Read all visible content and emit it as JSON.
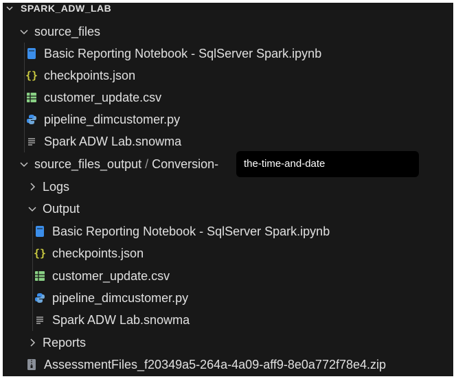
{
  "explorer": {
    "root": {
      "label": "SPARK_ADW_LAB",
      "expanded": true
    },
    "source_files": {
      "label": "source_files",
      "items": [
        {
          "label": "Basic Reporting Notebook - SqlServer Spark.ipynb",
          "icon": "notebook-icon"
        },
        {
          "label": "checkpoints.json",
          "icon": "json-braces-icon"
        },
        {
          "label": "customer_update.csv",
          "icon": "csv-table-icon"
        },
        {
          "label": "pipeline_dimcustomer.py",
          "icon": "python-icon"
        },
        {
          "label": "Spark ADW Lab.snowma",
          "icon": "text-lines-icon"
        }
      ]
    },
    "source_files_output": {
      "label": "source_files_output",
      "path_sep": " / ",
      "path_child": "Conversion-",
      "logs": {
        "label": "Logs"
      },
      "output": {
        "label": "Output",
        "items": [
          {
            "label": "Basic Reporting Notebook - SqlServer Spark.ipynb",
            "icon": "notebook-icon"
          },
          {
            "label": "checkpoints.json",
            "icon": "json-braces-icon"
          },
          {
            "label": "customer_update.csv",
            "icon": "csv-table-icon"
          },
          {
            "label": "pipeline_dimcustomer.py",
            "icon": "python-icon"
          },
          {
            "label": "Spark ADW Lab.snowma",
            "icon": "text-lines-icon"
          }
        ]
      },
      "reports": {
        "label": "Reports"
      }
    },
    "zip": {
      "label": "AssessmentFiles_f20349a5-264a-4a09-aff9-8e0a772f78e4.zip",
      "icon": "zip-file-icon"
    }
  },
  "tooltip": {
    "text": "the-time-and-date"
  },
  "colors": {
    "background": "#181818",
    "notebook": "#3b8eea",
    "json": "#cbcb41",
    "csv": "#89d185",
    "python": "#3572a5",
    "text": "#e0e0e0"
  }
}
